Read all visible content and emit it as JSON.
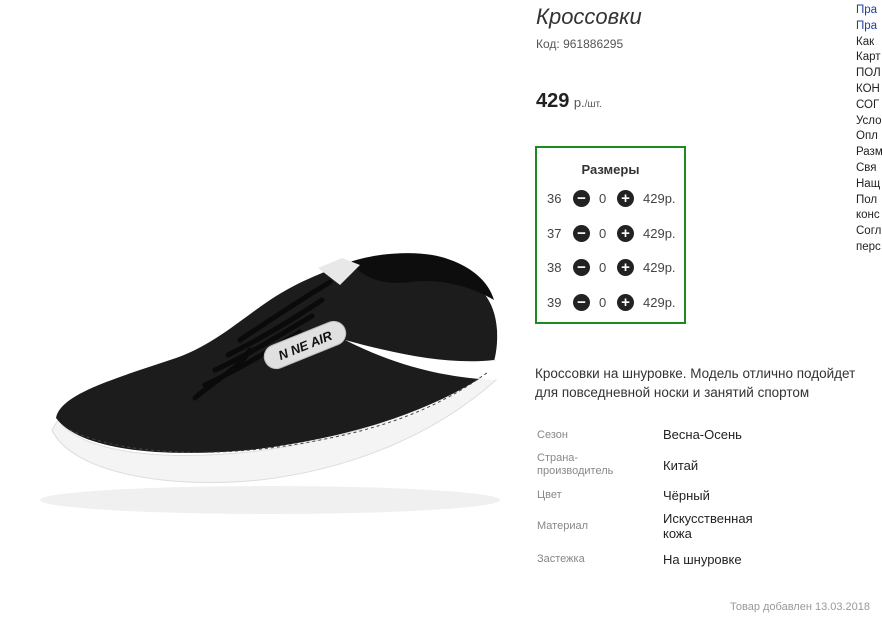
{
  "product": {
    "title": "Кроссовки",
    "code": "Код: 961886295",
    "price_value": "429",
    "price_currency": "р.",
    "price_unit": "/шт."
  },
  "sizes": {
    "title": "Размеры",
    "rows": [
      {
        "size": "36",
        "qty": "0",
        "price": "429р."
      },
      {
        "size": "37",
        "qty": "0",
        "price": "429р."
      },
      {
        "size": "38",
        "qty": "0",
        "price": "429р."
      },
      {
        "size": "39",
        "qty": "0",
        "price": "429р."
      }
    ]
  },
  "description": "Кроссовки на шнуровке. Модель отлично подойдет для повседневной носки и занятий спортом",
  "properties": [
    {
      "name": "Сезон",
      "value": "Весна-Осень"
    },
    {
      "name": "Страна-производитель",
      "value": "Китай"
    },
    {
      "name": "Цвет",
      "value": "Чёрный"
    },
    {
      "name": "Материал",
      "value": "Искусственная кожа"
    },
    {
      "name": "Застежка",
      "value": "На шнуровке"
    }
  ],
  "added_text": "Товар добавлен 13.03.2018",
  "sidebar_links": [
    "Пра",
    "Пра",
    "Как",
    "Карт",
    "ПОЛ",
    "КОН",
    "СОГ",
    "Усло",
    "Опл",
    "Разм",
    "Свя",
    "Нащ",
    "Пол",
    "конс",
    "Согл",
    "перс"
  ],
  "shoe_brand": "N NE AIR",
  "colors": {
    "accent_border": "#1e8a1e",
    "link": "#1a3fa8"
  }
}
